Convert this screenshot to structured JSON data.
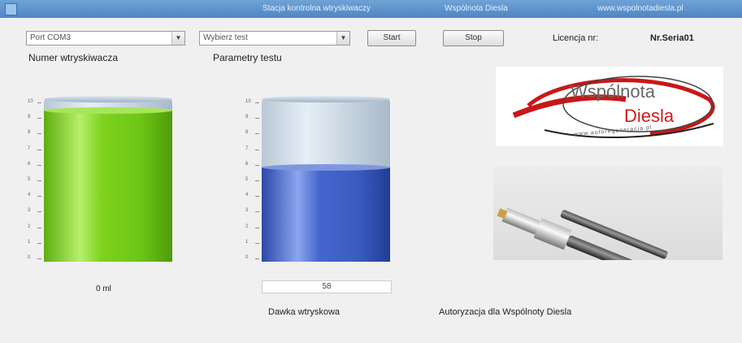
{
  "titlebar": {
    "title_left": "Stacja kontrolna wtryskiwaczy",
    "title_mid": "Wspólnota Diesla",
    "title_right": "www.wspolnotadiesla.pl"
  },
  "toolbar": {
    "port_combo_value": "Port COM3",
    "param_combo_value": "Wybierz test",
    "start_label": "Start",
    "stop_label": "Stop",
    "licence_label": "Licencja nr:",
    "licence_value": "Nr.Seria01"
  },
  "labels": {
    "left_heading": "Numer wtryskiwacza",
    "right_heading": "Parametry testu",
    "left_value": "0 ml",
    "right_value": "58",
    "bottom_mid": "Dawka wtryskowa",
    "bottom_right": "Autoryzacja dla Wspólnoty Diesla"
  },
  "gauges": {
    "ticks": [
      "10",
      "9",
      "8",
      "7",
      "6",
      "5",
      "4",
      "3",
      "2",
      "1",
      "0"
    ],
    "left_level": 0.93,
    "right_level": 0.58,
    "left_color": "#7fd21e",
    "right_color": "#3f60c6"
  },
  "logo": {
    "line1": "Wspólnota",
    "line2": "Diesla",
    "line3": "www.autoregeneracja.pl"
  }
}
